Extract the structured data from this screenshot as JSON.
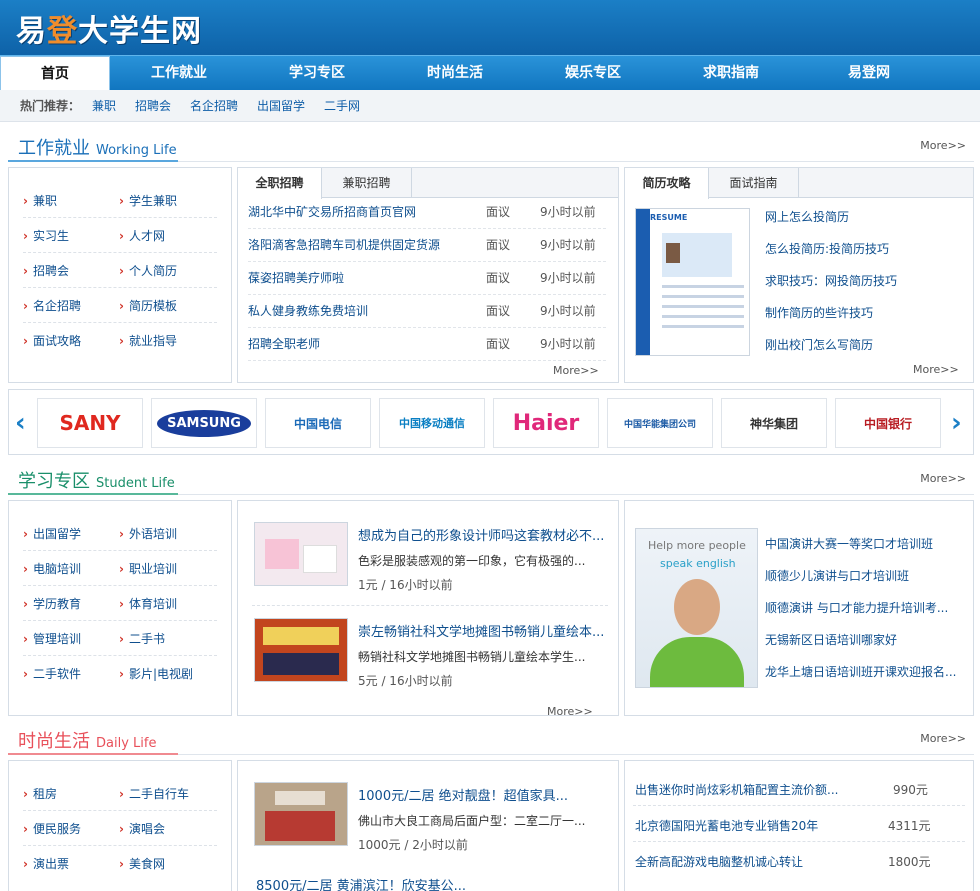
{
  "logo": {
    "pre": "易",
    "hl": "登",
    "post": "大学生网"
  },
  "nav": [
    "首页",
    "工作就业",
    "学习专区",
    "时尚生活",
    "娱乐专区",
    "求职指南",
    "易登网"
  ],
  "hot": {
    "label": "热门推荐：",
    "links": [
      "兼职",
      "招聘会",
      "名企招聘",
      "出国留学",
      "二手网"
    ]
  },
  "work": {
    "title": "工作就业",
    "en": "Working Life",
    "more": "More>>",
    "links": [
      [
        "兼职",
        "学生兼职"
      ],
      [
        "实习生",
        "人才网"
      ],
      [
        "招聘会",
        "个人简历"
      ],
      [
        "名企招聘",
        "简历模板"
      ],
      [
        "面试攻略",
        "就业指导"
      ]
    ],
    "tabs": [
      "全职招聘",
      "兼职招聘"
    ],
    "jobs": [
      {
        "t": "湖北华中矿交易所招商首页官网",
        "s": "面议",
        "tm": "9小时以前"
      },
      {
        "t": "洛阳滴客急招聘车司机提供固定货源",
        "s": "面议",
        "tm": "9小时以前"
      },
      {
        "t": "葆姿招聘美疗师啦",
        "s": "面议",
        "tm": "9小时以前"
      },
      {
        "t": "私人健身教练免费培训",
        "s": "面议",
        "tm": "9小时以前"
      },
      {
        "t": "招聘全职老师",
        "s": "面议",
        "tm": "9小时以前"
      }
    ],
    "jobs_more": "More>>",
    "tabs2": [
      "简历攻略",
      "面试指南"
    ],
    "resume_links": [
      "网上怎么投简历",
      "怎么投简历:投简历技巧",
      "求职技巧：网投简历技巧",
      "制作简历的些许技巧",
      "刚出校门怎么写简历"
    ],
    "resume_more": "More>>",
    "resume_label": "RESUME"
  },
  "brands": [
    {
      "name": "SANY",
      "color": "#e0281f"
    },
    {
      "name": "SAMSUNG",
      "color": "#1a3e9c"
    },
    {
      "name": "中国电信",
      "color": "#1c6bb8"
    },
    {
      "name": "中国移动通信",
      "color": "#0a7fc3"
    },
    {
      "name": "Haier",
      "color": "#e0287a"
    },
    {
      "name": "中国华能集团公司",
      "color": "#1b5aa5"
    },
    {
      "name": "神华集团",
      "color": "#333333"
    },
    {
      "name": "中国银行",
      "color": "#b81c22"
    }
  ],
  "study": {
    "title": "学习专区",
    "en": "Student Life",
    "more": "More>>",
    "links": [
      [
        "出国留学",
        "外语培训"
      ],
      [
        "电脑培训",
        "职业培训"
      ],
      [
        "学历教育",
        "体育培训"
      ],
      [
        "管理培训",
        "二手书"
      ],
      [
        "二手软件",
        "影片|电视剧"
      ]
    ],
    "posts": [
      {
        "title": "想成为自己的形象设计师吗这套教材必不...",
        "desc": "色彩是服装感观的第一印象，它有极强的...",
        "meta": "1元 / 16小时以前"
      },
      {
        "title": "崇左畅销社科文学地摊图书畅销儿童绘本...",
        "desc": "畅销社科文学地摊图书畅销儿童绘本学生...",
        "meta": "5元 / 16小时以前"
      }
    ],
    "posts_more": "More>>",
    "ad_line1": "Help more people",
    "ad_line2": "speak english",
    "eng_links": [
      "中国演讲大赛一等奖口才培训班",
      "顺德少儿演讲与口才培训班",
      "顺德演讲 与口才能力提升培训考...",
      "无锡新区日语培训哪家好",
      "龙华上塘日语培训班开课欢迎报名..."
    ]
  },
  "life": {
    "title": "时尚生活",
    "en": "Daily Life",
    "more": "More>>",
    "links": [
      [
        "租房",
        "二手自行车"
      ],
      [
        "便民服务",
        "演唱会"
      ],
      [
        "演出票",
        "美食网"
      ]
    ],
    "posts": [
      {
        "title": "1000元/二居 绝对靓盘！超值家具...",
        "desc": "佛山市大良工商局后面户型：二室二厅一...",
        "meta": "1000元 / 2小时以前"
      },
      {
        "title": "8500元/二居 黄浦滨江！欣安基公...",
        "desc": "",
        "meta": ""
      }
    ],
    "items": [
      {
        "t": "出售迷你时尚炫彩机箱配置主流价额...",
        "p": "990元"
      },
      {
        "t": "北京德国阳光蓄电池专业销售20年",
        "p": "4311元"
      },
      {
        "t": "全新高配游戏电脑整机诚心转让",
        "p": "1800元"
      }
    ]
  }
}
